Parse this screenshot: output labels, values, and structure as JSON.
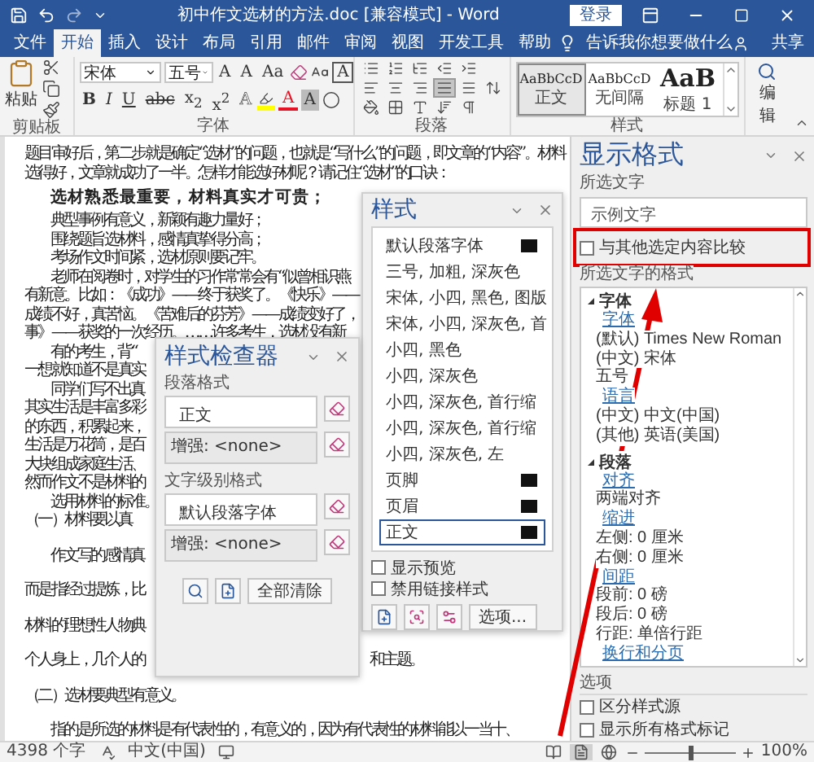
{
  "window": {
    "title": "初中作文选材的方法.doc [兼容模式] - Word",
    "sign_in": "登录"
  },
  "tabs": [
    {
      "label": "文件",
      "selected": false
    },
    {
      "label": "开始",
      "selected": true
    },
    {
      "label": "插入",
      "selected": false
    },
    {
      "label": "设计",
      "selected": false
    },
    {
      "label": "布局",
      "selected": false
    },
    {
      "label": "引用",
      "selected": false
    },
    {
      "label": "邮件",
      "selected": false
    },
    {
      "label": "审阅",
      "selected": false
    },
    {
      "label": "视图",
      "selected": false
    },
    {
      "label": "开发工具",
      "selected": false
    },
    {
      "label": "帮助",
      "selected": false
    }
  ],
  "tell_me": "告诉我你想要做什么",
  "share": "共享",
  "ribbon": {
    "clipboard": {
      "paste": "粘贴",
      "label": "剪贴板"
    },
    "font": {
      "label": "字体",
      "font_name": "宋体",
      "font_size": "五号",
      "top_row": [
        {
          "kind": "plain",
          "label": "A"
        },
        {
          "kind": "plain",
          "label": "A"
        },
        {
          "kind": "plain",
          "label": "Aa"
        },
        {
          "kind": "eraser"
        },
        {
          "kind": "phonetic"
        },
        {
          "kind": "boxed",
          "label": "A"
        }
      ],
      "bottom_row": [
        {
          "kind": "bold",
          "label": "B"
        },
        {
          "kind": "italic",
          "label": "I"
        },
        {
          "kind": "underline",
          "label": "U"
        },
        {
          "kind": "strike",
          "label": "abc"
        },
        {
          "kind": "plain",
          "label": "x$_{2}$"
        },
        {
          "kind": "plain",
          "label": "x$^{2}$"
        },
        {
          "kind": "outline",
          "label": "A"
        },
        {
          "kind": "highlight",
          "color": "#ffff00"
        },
        {
          "kind": "colored",
          "label": "A",
          "color": "#e81123"
        },
        {
          "kind": "shaded",
          "label": "A"
        },
        {
          "kind": "enclose"
        }
      ]
    },
    "paragraph": {
      "label": "段落",
      "row_1": [
        {
          "kind": "bullets",
          "selected": false
        },
        {
          "kind": "numbering",
          "selected": false
        },
        {
          "kind": "multilevel",
          "selected": false
        },
        {
          "kind": "outdent",
          "selected": false
        },
        {
          "kind": "indent",
          "selected": false
        }
      ],
      "row_2": [
        {
          "kind": "left",
          "selected": false
        },
        {
          "kind": "center",
          "selected": false
        },
        {
          "kind": "right",
          "selected": false
        },
        {
          "kind": "justify",
          "selected": true
        },
        {
          "kind": "distribute",
          "selected": false
        },
        {
          "kind": "spacing",
          "selected": false
        }
      ],
      "row_3": [
        {
          "kind": "shading",
          "selected": false
        },
        {
          "kind": "borders",
          "selected": false
        },
        {
          "kind": "asian",
          "selected": false
        },
        {
          "kind": "sort",
          "selected": false
        },
        {
          "kind": "marks",
          "selected": false
        }
      ]
    },
    "styles": {
      "label": "样式",
      "gallery": [
        {
          "sample": "AaBbCcD",
          "name": "正文",
          "kind": "normal",
          "selected": true
        },
        {
          "sample": "AaBbCcD",
          "name": "无间隔",
          "kind": "normal",
          "selected": false
        },
        {
          "sample": "AaB",
          "name": "标题 1",
          "kind": "heading",
          "selected": false
        }
      ]
    },
    "editing": {
      "label": "编辑"
    }
  },
  "document": {
    "lines": [
      {
        "kind": "plain",
        "indent": false,
        "text": "题目审好后，第二步就是确定“选材”的问题，也就是“写什么”的问题，即文章的“内容”。材料选得好，文章就成功了一半。怎样才能选好材呢？请记住“选材”的口诀："
      },
      {
        "kind": "verse",
        "indent": true,
        "text": "选材熟悉最重要，材料真实才可贵；"
      },
      {
        "kind": "plain",
        "indent": true,
        "text": "典型事例有意义，新颖有趣力量好；"
      },
      {
        "kind": "plain",
        "indent": true,
        "text": "围绕题旨选材料，感情真挚得分高；"
      },
      {
        "kind": "plain",
        "indent": true,
        "text": "考场作文时间紧，选材原则要记牢。"
      },
      {
        "kind": "plain",
        "indent": true,
        "text": "老师在阅卷时，对学生的习作常常会有“似曾相识燕"
      },
      {
        "kind": "plain",
        "indent": false,
        "text": "有新意。比如：《成功》——终于获奖了。《快乐》——"
      },
      {
        "kind": "plain",
        "indent": false,
        "text": "成绩不好，真苦恼。《苦难后的芬芳》——成绩变好了，"
      },
      {
        "kind": "plain",
        "indent": false,
        "text": "事》——获奖的一次经历。……许多考生，选材没有新"
      },
      {
        "kind": "plain",
        "indent": true,
        "text": "有的考生，背“"
      },
      {
        "kind": "plain",
        "indent": false,
        "text": "一想就知道不是真实"
      },
      {
        "kind": "plain",
        "indent": true,
        "text": "同学们写不出真"
      },
      {
        "kind": "plain",
        "indent": false,
        "text": "其实生活是丰富多彩"
      },
      {
        "kind": "plain",
        "indent": false,
        "text": "的东西，积累起来，"
      },
      {
        "kind": "plain",
        "indent": false,
        "text": "生活是万花筒，是百"
      },
      {
        "kind": "plain",
        "indent": false,
        "text": "大块组成家庭生活、"
      },
      {
        "kind": "plain",
        "indent": false,
        "text": "然而作文不是材料的"
      },
      {
        "kind": "plain",
        "indent": true,
        "text": "选用材料的标准。"
      },
      {
        "kind": "plain",
        "indent": false,
        "text": "（一）材料要以真"
      }
    ],
    "spaced_lines": [
      {
        "indent": true,
        "text": "作文写的感情真"
      },
      {
        "indent": false,
        "text": "而是指经过提炼，比"
      },
      {
        "indent": false,
        "text": "材料的理想性人物典"
      },
      {
        "indent": false,
        "text": "个人身上，几个人的",
        "tail": "和主题。"
      },
      {
        "indent": false,
        "text": "（二）选材要典型有意义。"
      },
      {
        "indent": true,
        "text": "指的是所选的材料是有代表性的，有意义的，因为有代表性的材料能以一当十、"
      }
    ]
  },
  "styles_pane": {
    "title": "样式",
    "items": [
      {
        "name": "默认段落字体",
        "symbol": true,
        "selected": false
      },
      {
        "name": "三号, 加粗, 深灰色",
        "symbol": false,
        "selected": false
      },
      {
        "name": "宋体, 小四, 黑色, 图版",
        "symbol": false,
        "selected": false
      },
      {
        "name": "宋体, 小四, 深灰色, 首",
        "symbol": false,
        "selected": false
      },
      {
        "name": "小四, 黑色",
        "symbol": false,
        "selected": false
      },
      {
        "name": "小四, 深灰色",
        "symbol": false,
        "selected": false
      },
      {
        "name": "小四, 深灰色, 首行缩",
        "symbol": false,
        "selected": false
      },
      {
        "name": "小四, 深灰色, 首行缩",
        "symbol": false,
        "selected": false
      },
      {
        "name": "小四, 深灰色, 左",
        "symbol": false,
        "selected": false
      },
      {
        "name": "页脚",
        "symbol": true,
        "selected": false
      },
      {
        "name": "页眉",
        "symbol": true,
        "selected": false
      },
      {
        "name": "正文",
        "symbol": true,
        "selected": true
      }
    ],
    "options": [
      {
        "label": "显示预览",
        "checked": false
      },
      {
        "label": "禁用链接样式",
        "checked": false
      }
    ],
    "options_button": "选项..."
  },
  "inspector": {
    "title": "样式检查器",
    "paragraph_label": "段落格式",
    "paragraph_style": "正文",
    "paragraph_extra": "增强: <none>",
    "text_label": "文字级别格式",
    "text_style": "默认段落字体",
    "text_extra": "增强: <none>",
    "clear_all": "全部清除"
  },
  "reveal": {
    "title": "显示格式",
    "selected_label": "所选文字",
    "sample": "示例文字",
    "compare": {
      "label": "与其他选定内容比较",
      "checked": false
    },
    "formatting_label": "所选文字的格式",
    "sections": [
      {
        "label": "字体",
        "expanded": true,
        "children": [
          {
            "kind": "link",
            "text": "字体"
          },
          {
            "kind": "value",
            "text": "(默认) Times New Roman"
          },
          {
            "kind": "value",
            "text": "(中文) 宋体"
          },
          {
            "kind": "value",
            "text": "五号"
          },
          {
            "kind": "link",
            "text": "语言"
          },
          {
            "kind": "value",
            "text": "(中文) 中文(中国)"
          },
          {
            "kind": "value",
            "text": "(其他) 英语(美国)"
          }
        ]
      },
      {
        "label": "段落",
        "expanded": true,
        "children": [
          {
            "kind": "link",
            "text": "对齐"
          },
          {
            "kind": "value",
            "text": "两端对齐"
          },
          {
            "kind": "link",
            "text": "缩进"
          },
          {
            "kind": "value",
            "text": "左侧:  0 厘米"
          },
          {
            "kind": "value",
            "text": "右侧:  0 厘米"
          },
          {
            "kind": "link",
            "text": "间距"
          },
          {
            "kind": "value",
            "text": "段前: 0 磅"
          },
          {
            "kind": "value",
            "text": "段后: 0 磅"
          },
          {
            "kind": "value",
            "text": "行距: 单倍行距"
          },
          {
            "kind": "link",
            "text": "换行和分页"
          }
        ]
      }
    ],
    "options_label": "选项",
    "options": [
      {
        "label": "区分样式源",
        "checked": false
      },
      {
        "label": "显示所有格式标记",
        "checked": false
      }
    ]
  },
  "status_bar": {
    "words": "4398 个字",
    "language": "中文(中国)",
    "views": [
      {
        "kind": "read",
        "selected": false
      },
      {
        "kind": "print",
        "selected": true
      },
      {
        "kind": "web",
        "selected": false
      }
    ],
    "zoom": {
      "level": 0.5,
      "reading": "100%"
    }
  }
}
